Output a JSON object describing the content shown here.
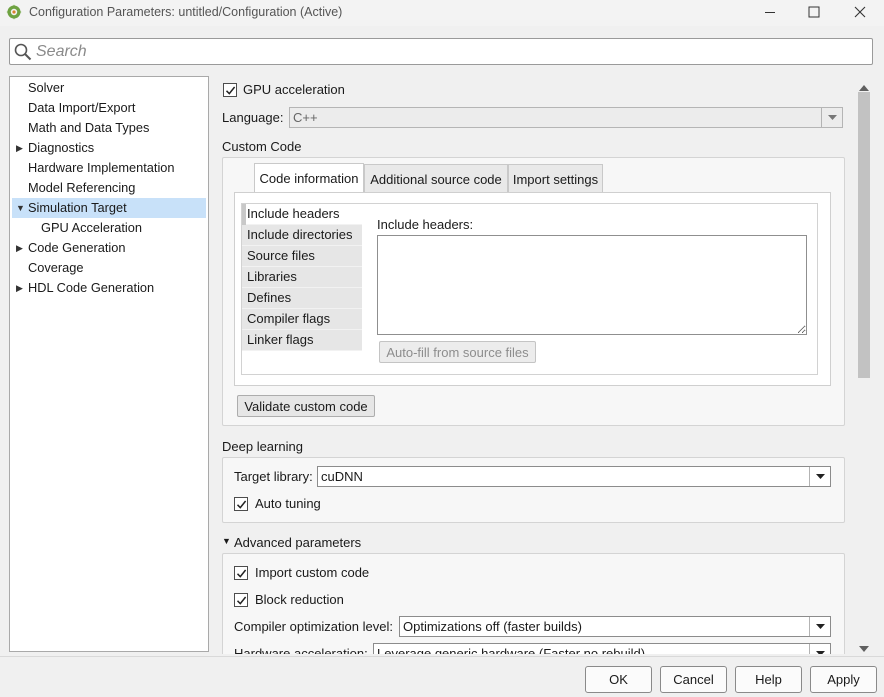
{
  "window": {
    "title": "Configuration Parameters: untitled/Configuration (Active)",
    "minimize_icon": "minimize-icon",
    "maximize_icon": "maximize-icon",
    "close_icon": "close-icon"
  },
  "search": {
    "placeholder": "Search",
    "value": ""
  },
  "tree": {
    "items": [
      {
        "label": "Solver",
        "expandable": false,
        "selected": false,
        "level": 0
      },
      {
        "label": "Data Import/Export",
        "expandable": false,
        "selected": false,
        "level": 0
      },
      {
        "label": "Math and Data Types",
        "expandable": false,
        "selected": false,
        "level": 0
      },
      {
        "label": "Diagnostics",
        "expandable": true,
        "expanded": false,
        "selected": false,
        "level": 0
      },
      {
        "label": "Hardware Implementation",
        "expandable": false,
        "selected": false,
        "level": 0
      },
      {
        "label": "Model Referencing",
        "expandable": false,
        "selected": false,
        "level": 0
      },
      {
        "label": "Simulation Target",
        "expandable": true,
        "expanded": true,
        "selected": true,
        "level": 0
      },
      {
        "label": "GPU Acceleration",
        "expandable": false,
        "selected": false,
        "level": 1
      },
      {
        "label": "Code Generation",
        "expandable": true,
        "expanded": false,
        "selected": false,
        "level": 0
      },
      {
        "label": "Coverage",
        "expandable": false,
        "selected": false,
        "level": 0
      },
      {
        "label": "HDL Code Generation",
        "expandable": true,
        "expanded": false,
        "selected": false,
        "level": 0
      }
    ]
  },
  "gpu_acceleration": {
    "label": "GPU acceleration",
    "checked": true
  },
  "language": {
    "label": "Language:",
    "value": "C++"
  },
  "custom_code": {
    "heading": "Custom Code",
    "tabs": [
      "Code information",
      "Additional source code",
      "Import settings"
    ],
    "active_tab": 0,
    "side_tabs": [
      "Include headers",
      "Include directories",
      "Source files",
      "Libraries",
      "Defines",
      "Compiler flags",
      "Linker flags"
    ],
    "active_side_tab": 0,
    "field_label": "Include headers:",
    "field_value": "",
    "autofill_label": "Auto-fill from source files",
    "validate_label": "Validate custom code"
  },
  "deep_learning": {
    "heading": "Deep learning",
    "target_library_label": "Target library:",
    "target_library_value": "cuDNN",
    "auto_tuning_label": "Auto tuning",
    "auto_tuning_checked": true
  },
  "advanced": {
    "heading": "Advanced parameters",
    "import_custom_code_label": "Import custom code",
    "import_custom_code_checked": true,
    "block_reduction_label": "Block reduction",
    "block_reduction_checked": true,
    "compiler_opt_label": "Compiler optimization level:",
    "compiler_opt_value": "Optimizations off (faster builds)",
    "hardware_accel_label": "Hardware acceleration:",
    "hardware_accel_value": "Leverage generic hardware (Faster no rebuild)"
  },
  "buttons": {
    "ok": "OK",
    "cancel": "Cancel",
    "help": "Help",
    "apply": "Apply"
  }
}
